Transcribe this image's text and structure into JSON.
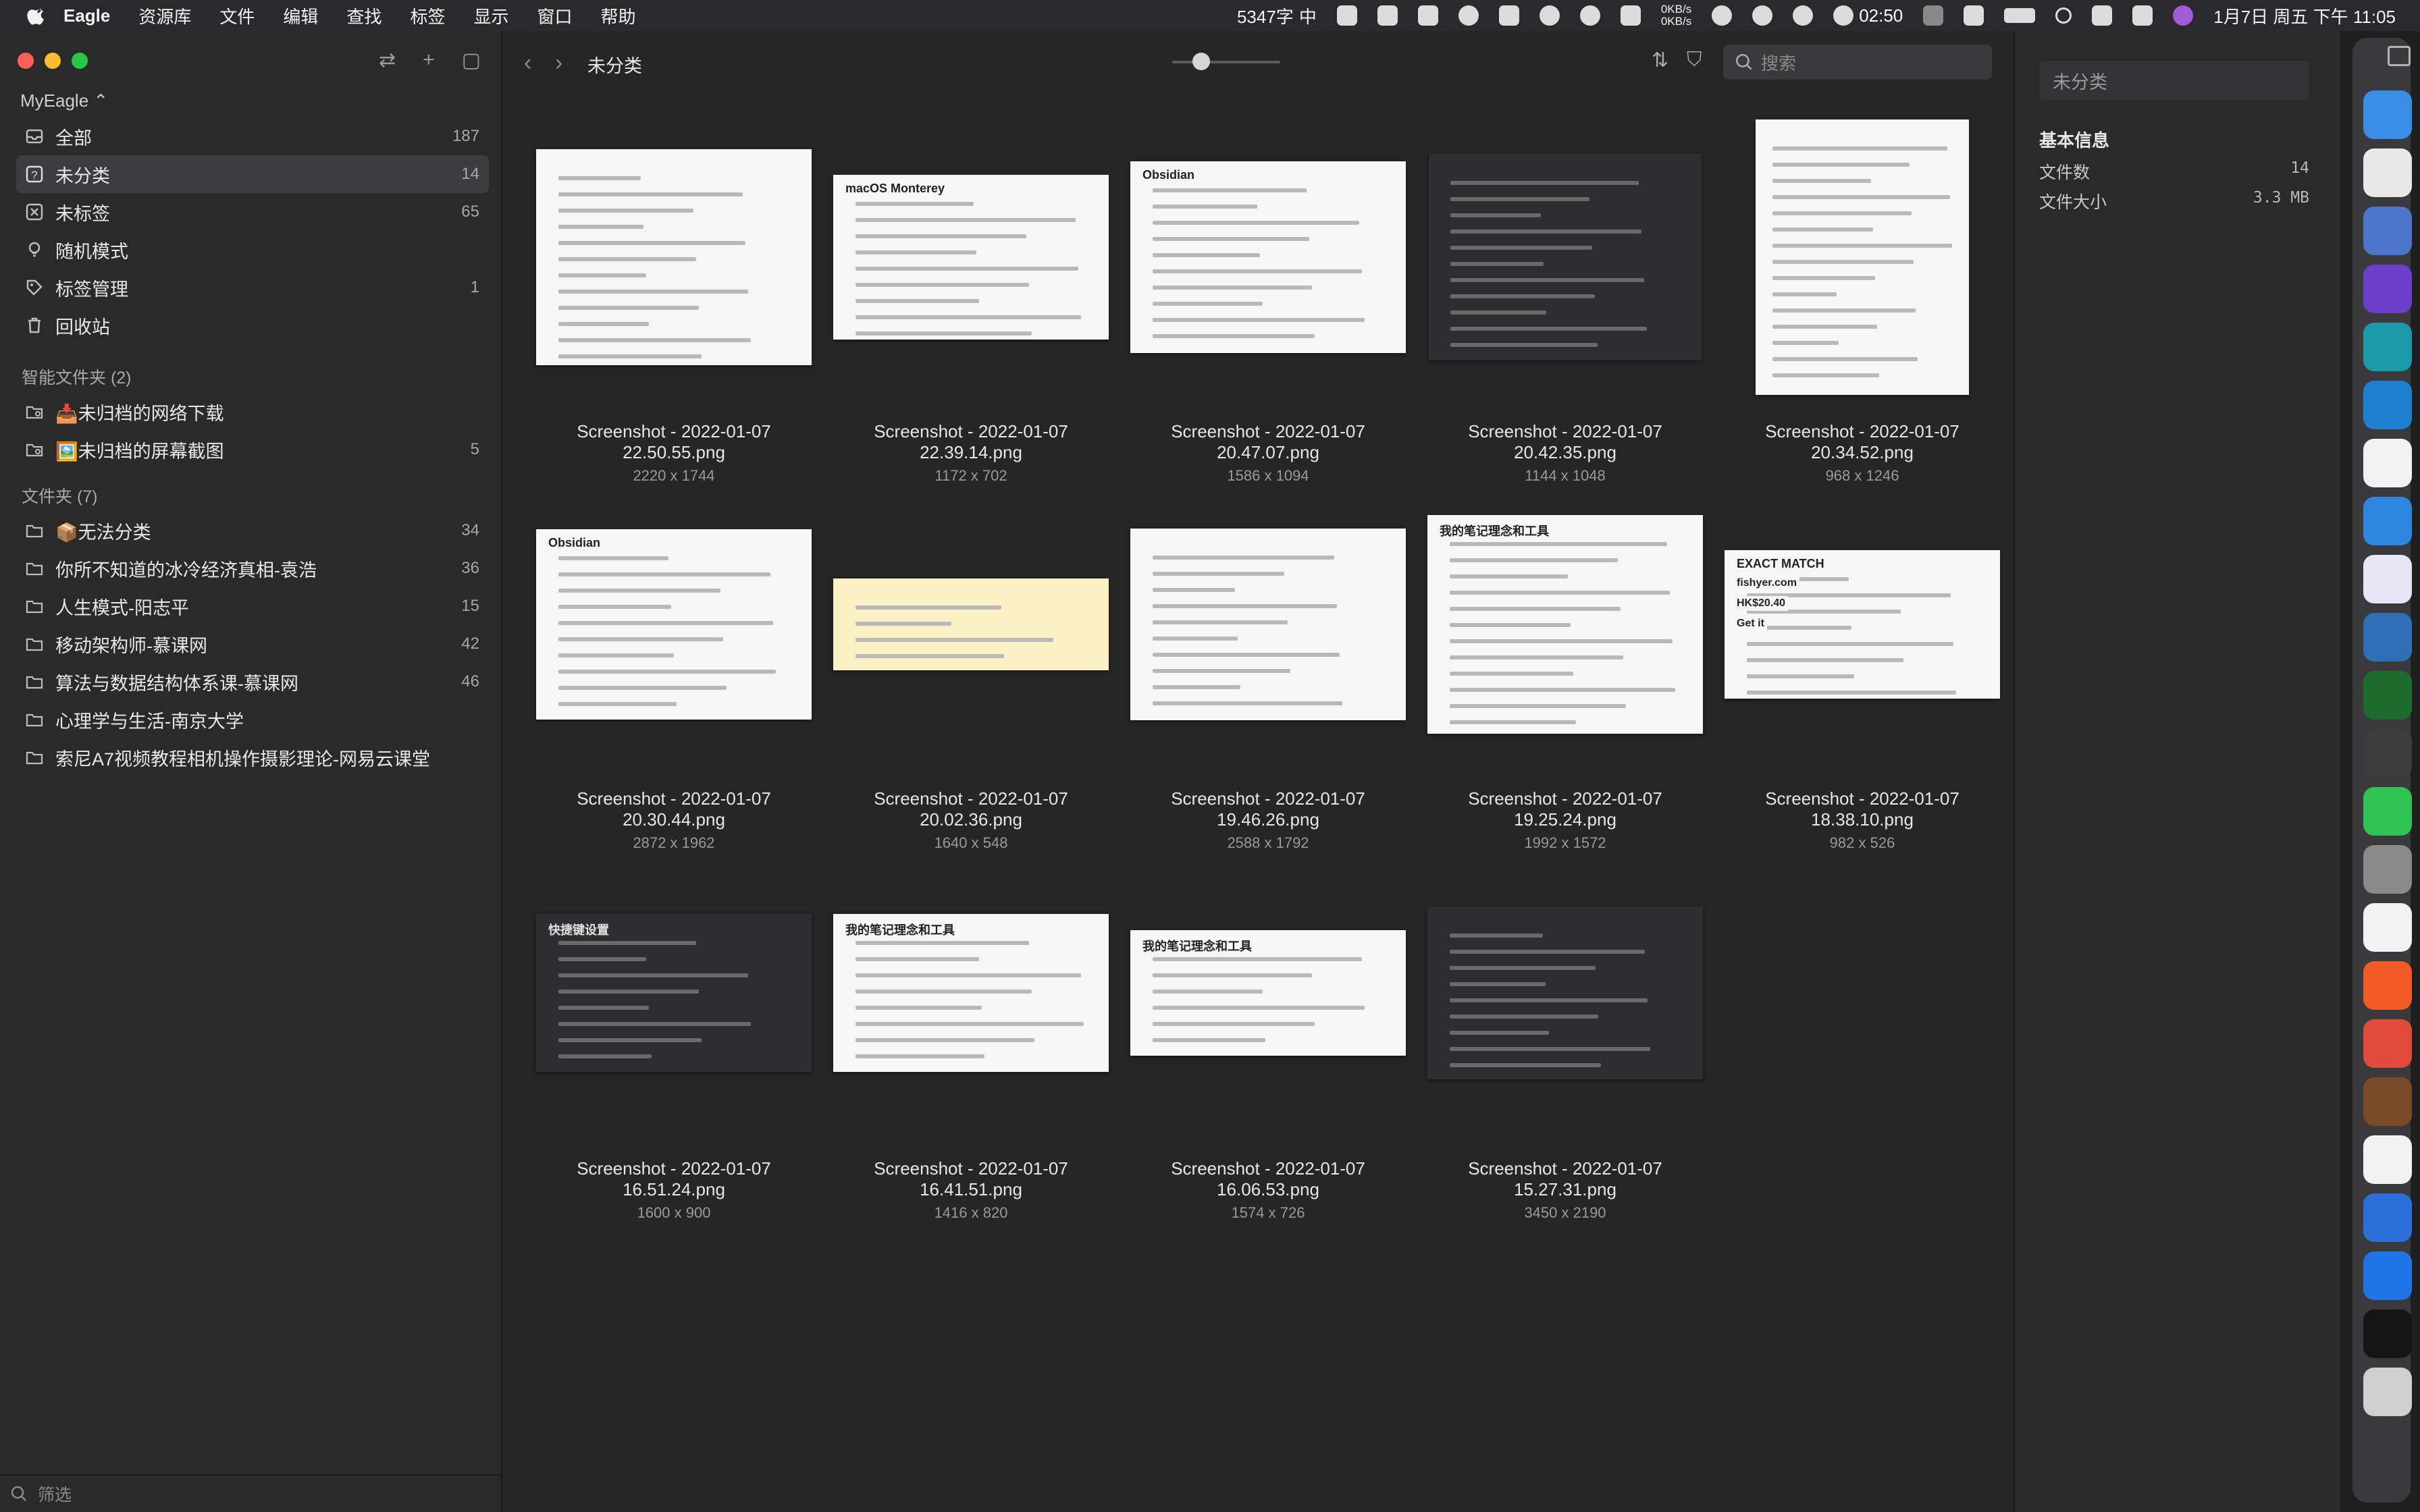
{
  "menubar": {
    "app_name": "Eagle",
    "menus": [
      "资源库",
      "文件",
      "编辑",
      "查找",
      "标签",
      "显示",
      "窗口",
      "帮助"
    ],
    "word_count": "5347字",
    "input_method": "中",
    "net_up": "0KB/s",
    "net_down": "0KB/s",
    "timer": "02:50",
    "datetime": "1月7日 周五 下午 11:05"
  },
  "sidebar": {
    "library": "MyEagle",
    "nav": [
      {
        "label": "全部",
        "count": "187",
        "icon": "tray-icon"
      },
      {
        "label": "未分类",
        "count": "14",
        "icon": "question-folder-icon",
        "selected": true
      },
      {
        "label": "未标签",
        "count": "65",
        "icon": "tag-off-icon"
      },
      {
        "label": "随机模式",
        "count": "",
        "icon": "bulb-icon"
      },
      {
        "label": "标签管理",
        "count": "1",
        "icon": "tag-icon"
      },
      {
        "label": "回收站",
        "count": "",
        "icon": "trash-icon"
      }
    ],
    "smart_header": "智能文件夹 (2)",
    "smart_folders": [
      {
        "label": "📥未归档的网络下载",
        "count": ""
      },
      {
        "label": "🖼️未归档的屏幕截图",
        "count": "5"
      }
    ],
    "folders_header": "文件夹 (7)",
    "folders": [
      {
        "label": "📦无法分类",
        "count": "34"
      },
      {
        "label": "你所不知道的冰冷经济真相-袁浩",
        "count": "36"
      },
      {
        "label": "人生模式-阳志平",
        "count": "15"
      },
      {
        "label": "移动架构师-慕课网",
        "count": "42"
      },
      {
        "label": "算法与数据结构体系课-慕课网",
        "count": "46"
      },
      {
        "label": "心理学与生活-南京大学",
        "count": ""
      },
      {
        "label": "索尼A7视频教程相机操作摄影理论-网易云课堂",
        "count": ""
      }
    ],
    "filter_placeholder": "筛选"
  },
  "main": {
    "title": "未分类",
    "search_placeholder": "搜索",
    "items": [
      {
        "name": "Screenshot - 2022-01-07\n22.50.55.png",
        "dims": "2220 x 1744",
        "style": "light"
      },
      {
        "name": "Screenshot - 2022-01-07\n22.39.14.png",
        "dims": "1172 x 702",
        "style": "light",
        "texts": [
          "macOS Monterey"
        ]
      },
      {
        "name": "Screenshot - 2022-01-07\n20.47.07.png",
        "dims": "1586 x 1094",
        "style": "light",
        "texts": [
          "Obsidian"
        ]
      },
      {
        "name": "Screenshot - 2022-01-07\n20.42.35.png",
        "dims": "1144 x 1048",
        "style": "dark"
      },
      {
        "name": "Screenshot - 2022-01-07\n20.34.52.png",
        "dims": "968 x 1246",
        "style": "light"
      },
      {
        "name": "Screenshot - 2022-01-07\n20.30.44.png",
        "dims": "2872 x 1962",
        "style": "light",
        "texts": [
          "Obsidian"
        ]
      },
      {
        "name": "Screenshot - 2022-01-07\n20.02.36.png",
        "dims": "1640 x 548",
        "style": "yellow"
      },
      {
        "name": "Screenshot - 2022-01-07\n19.46.26.png",
        "dims": "2588 x 1792",
        "style": "light"
      },
      {
        "name": "Screenshot - 2022-01-07\n19.25.24.png",
        "dims": "1992 x 1572",
        "style": "light",
        "texts": [
          "我的笔记理念和工具"
        ]
      },
      {
        "name": "Screenshot - 2022-01-07\n18.38.10.png",
        "dims": "982 x 526",
        "style": "light",
        "texts": [
          "EXACT MATCH",
          "fishyer.com",
          "HK$20.40",
          "Get it"
        ]
      },
      {
        "name": "Screenshot - 2022-01-07\n16.51.24.png",
        "dims": "1600 x 900",
        "style": "dark",
        "texts": [
          "快捷键设置"
        ]
      },
      {
        "name": "Screenshot - 2022-01-07\n16.41.51.png",
        "dims": "1416 x 820",
        "style": "light",
        "texts": [
          "我的笔记理念和工具"
        ]
      },
      {
        "name": "Screenshot - 2022-01-07\n16.06.53.png",
        "dims": "1574 x 726",
        "style": "light",
        "texts": [
          "我的笔记理念和工具"
        ]
      },
      {
        "name": "Screenshot - 2022-01-07\n15.27.31.png",
        "dims": "3450 x 2190",
        "style": "dark"
      }
    ]
  },
  "inspector": {
    "title": "未分类",
    "section": "基本信息",
    "rows": [
      {
        "label": "文件数",
        "value": "14"
      },
      {
        "label": "文件大小",
        "value": "3.3 MB"
      }
    ]
  },
  "dock": {
    "apps": [
      {
        "name": "finder-icon",
        "color": "#3a8ee6"
      },
      {
        "name": "chrome-icon",
        "color": "#e8e8e8"
      },
      {
        "name": "todo-list-icon",
        "color": "#4a77c9"
      },
      {
        "name": "obsidian-icon",
        "color": "#6b3fc9"
      },
      {
        "name": "app-teal-icon",
        "color": "#1b9aa8"
      },
      {
        "name": "vscode-icon",
        "color": "#1e7fd1"
      },
      {
        "name": "tick-icon",
        "color": "#f2f2f2"
      },
      {
        "name": "app-blue-icon",
        "color": "#2d87e0"
      },
      {
        "name": "app-gradient-icon",
        "color": "#e6e6f5"
      },
      {
        "name": "dictionary-icon",
        "color": "#2f6fb6"
      },
      {
        "name": "app-green-icon",
        "color": "#1d6b2d"
      },
      {
        "name": "alfred-icon",
        "color": "#3c3c3c"
      },
      {
        "name": "wechat-icon",
        "color": "#2ec353"
      },
      {
        "name": "system-preferences-icon",
        "color": "#8a8a8a"
      },
      {
        "name": "app-store-icon",
        "color": "#f2f2f2"
      },
      {
        "name": "paper-plane-icon",
        "color": "#f25c24"
      },
      {
        "name": "app-ring-icon",
        "color": "#e14b3c"
      },
      {
        "name": "books-icon",
        "color": "#7a4a26"
      },
      {
        "name": "wps-icon",
        "color": "#f2f2f2"
      },
      {
        "name": "app-video-icon",
        "color": "#2c6fd8"
      },
      {
        "name": "maps-icon",
        "color": "#1f74e8"
      },
      {
        "name": "terminal-icon",
        "color": "#151515"
      },
      {
        "name": "trash-icon",
        "color": "#cfcfcf"
      }
    ]
  }
}
